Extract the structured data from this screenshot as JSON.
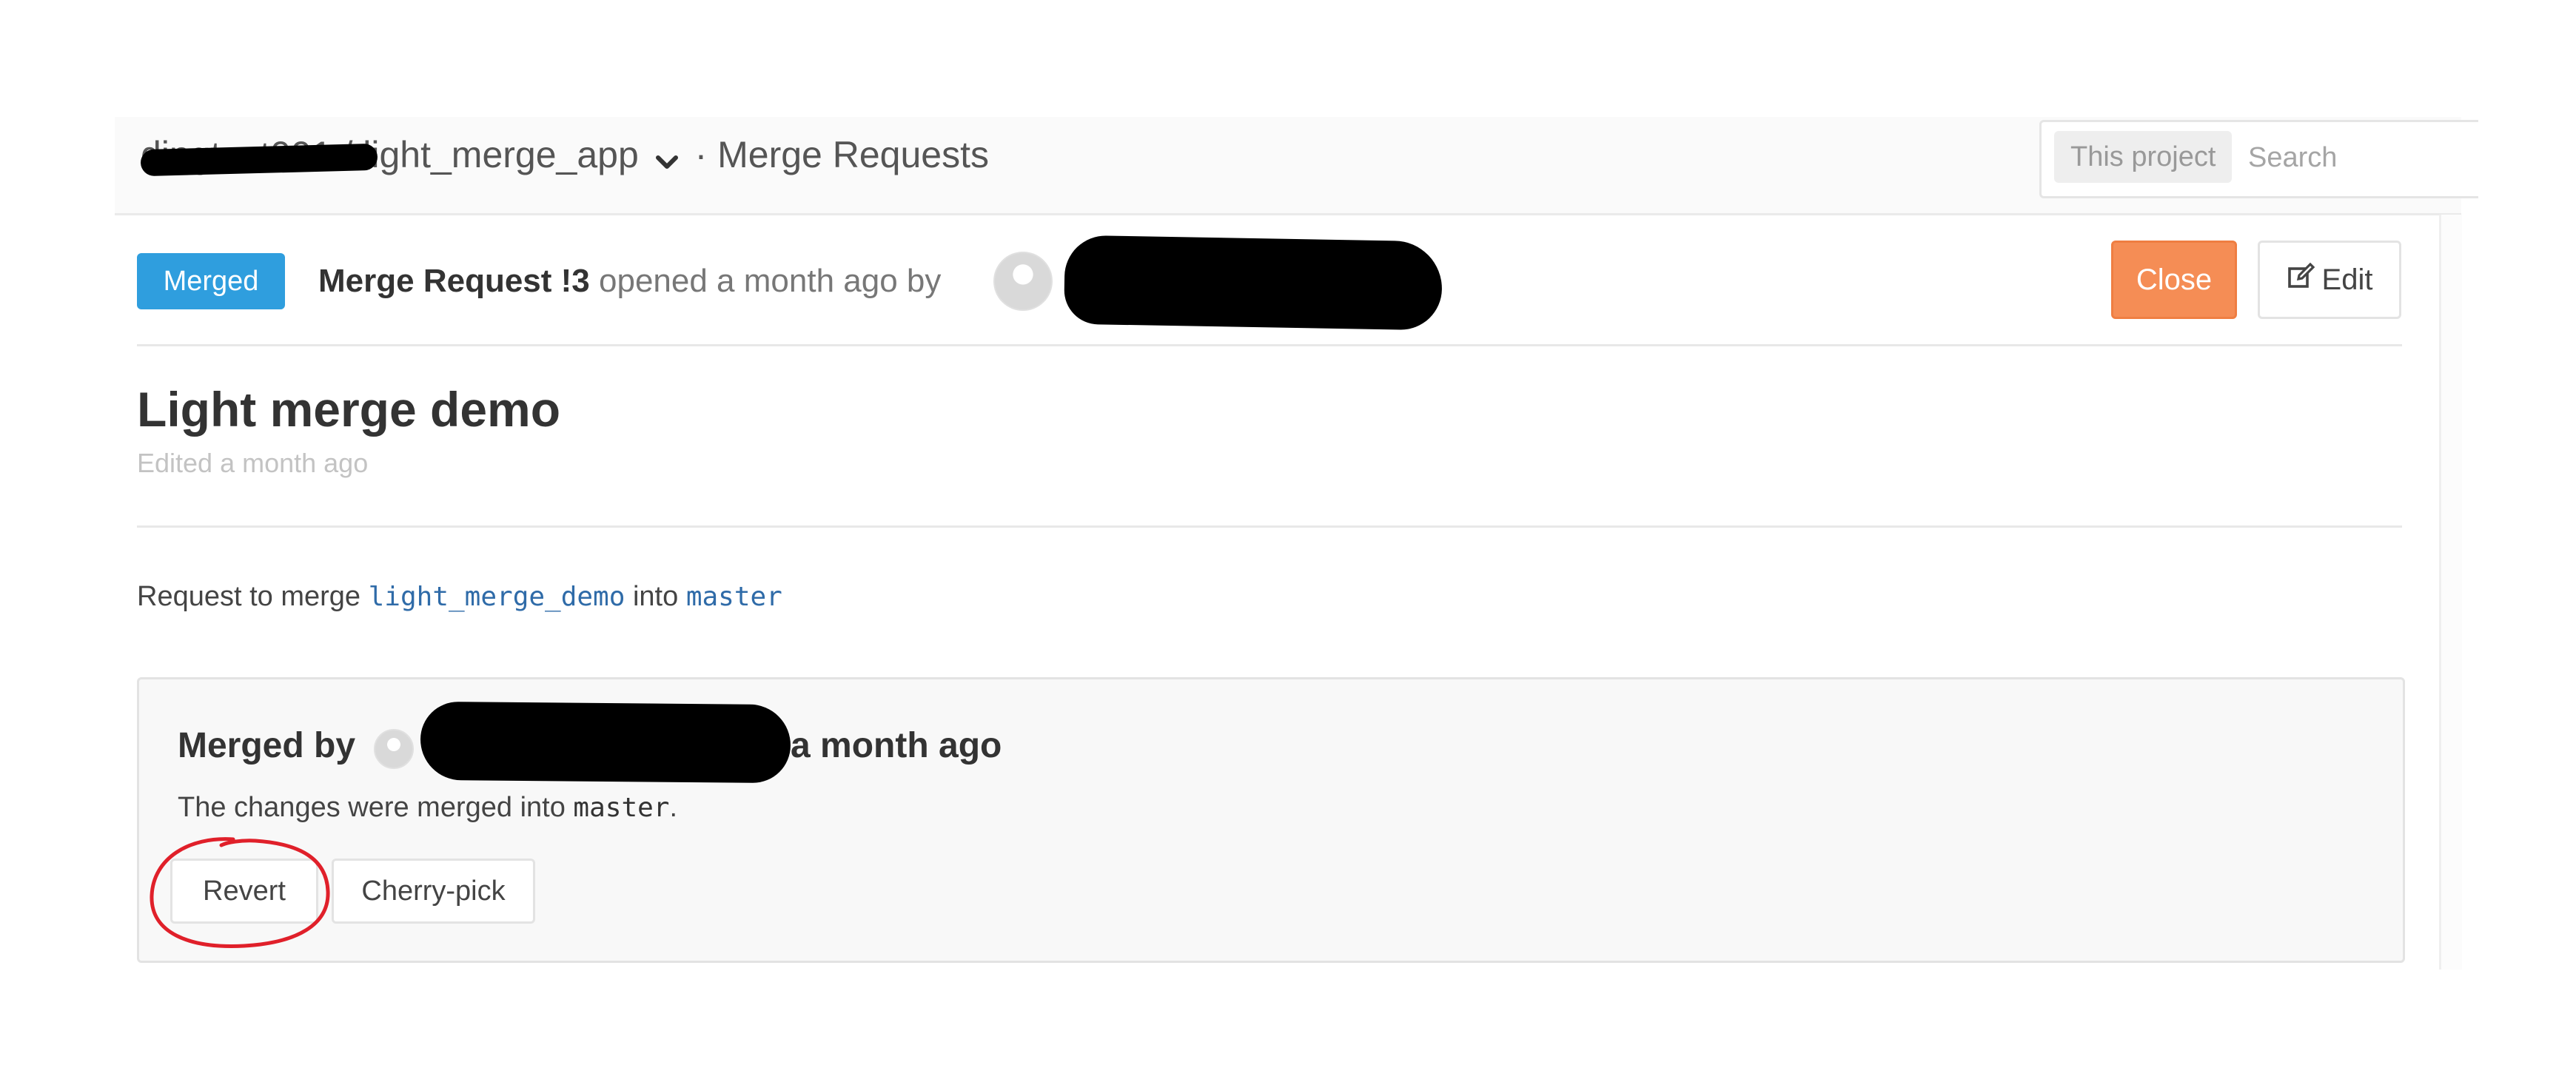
{
  "header": {
    "group": "dingtest001",
    "separator": "/",
    "project": "light_merge_app",
    "section_separator": "·",
    "section": "Merge Requests"
  },
  "search": {
    "scope_label": "This project",
    "placeholder": "Search"
  },
  "merge_request": {
    "status_badge": "Merged",
    "ref_label": "Merge Request !3",
    "opened_text": "opened a month ago by",
    "actions": {
      "close_label": "Close",
      "edit_label": "Edit"
    },
    "title": "Light merge demo",
    "edited_text": "Edited a month ago",
    "merge_prefix": "Request to merge",
    "source_branch": "light_merge_demo",
    "merge_into_word": "into",
    "target_branch": "master"
  },
  "merge_widget": {
    "merged_by_label": "Merged by",
    "merged_time": "a month ago",
    "merged_into_text": "The changes were merged into",
    "merged_into_branch": "master",
    "merged_into_suffix": ".",
    "revert_label": "Revert",
    "cherry_pick_label": "Cherry-pick"
  },
  "icons": {
    "project_dropdown": "chevron-down-icon",
    "edit": "edit-icon",
    "author_avatar": "avatar",
    "merger_avatar": "avatar"
  },
  "colors": {
    "merged_badge": "#2f9ede",
    "close_button": "#f58d55",
    "branch_code": "#2f6ba8",
    "annotation_circle": "#e0202a"
  }
}
